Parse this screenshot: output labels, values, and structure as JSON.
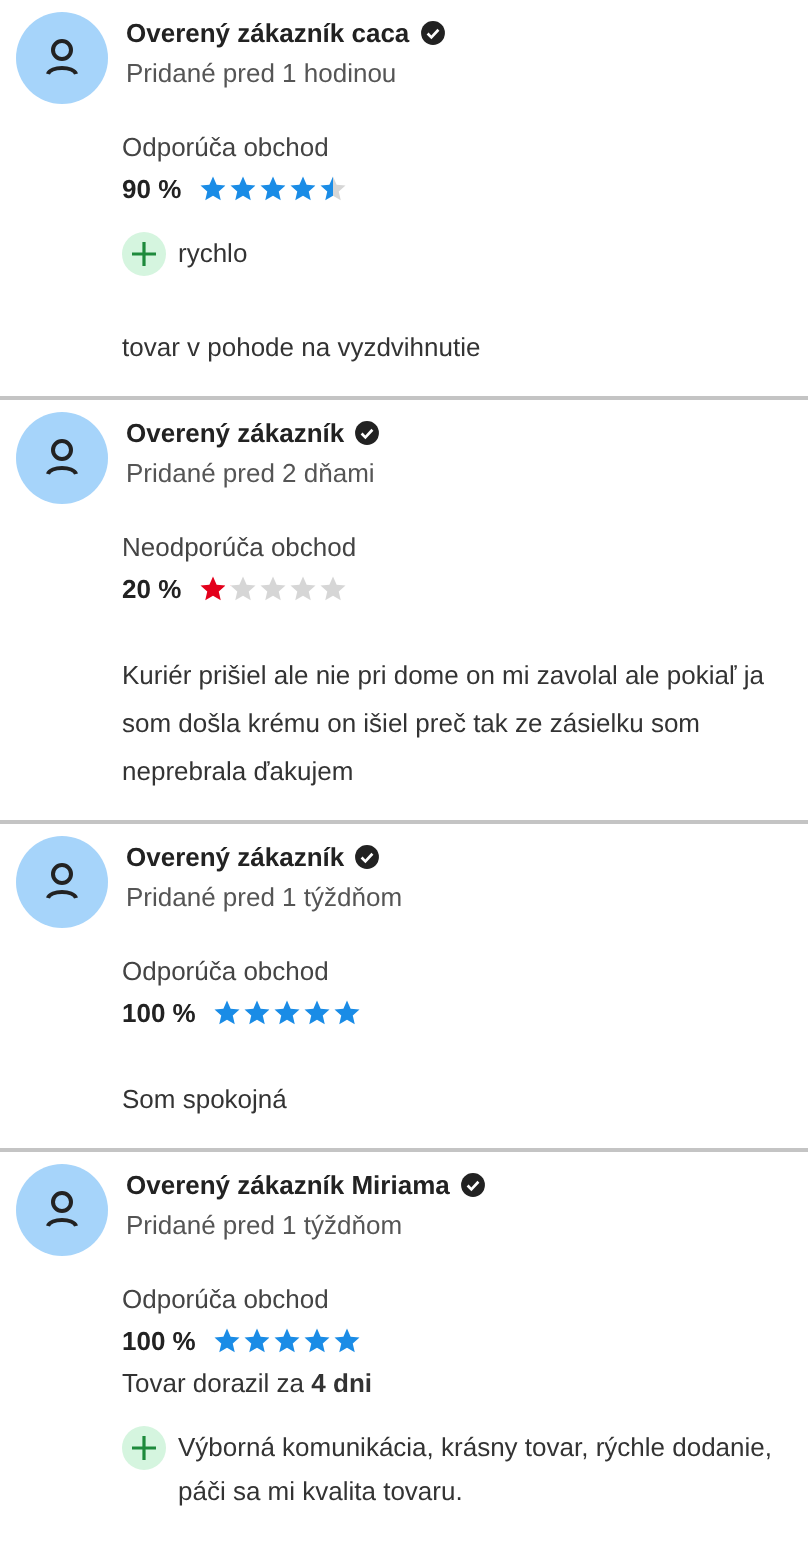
{
  "reviews": [
    {
      "author": "Overený zákazník caca",
      "verified": true,
      "date": "Pridané pred 1 hodinou",
      "verdict": "Odporúča obchod",
      "recommends": true,
      "percent": "90 %",
      "stars": 4.5,
      "pros": [
        "rychlo"
      ],
      "text": "tovar v pohode na vyzdvihnutie"
    },
    {
      "author": "Overený zákazník",
      "verified": true,
      "date": "Pridané pred 2 dňami",
      "verdict": "Neodporúča obchod",
      "recommends": false,
      "percent": "20 %",
      "stars": 1,
      "text": "Kuriér prišiel ale nie pri dome on mi zavolal ale pokiaľ ja som došla krému on išiel preč tak ze zásielku som neprebrala ďakujem"
    },
    {
      "author": "Overený zákazník",
      "verified": true,
      "date": "Pridané pred 1 týždňom",
      "verdict": "Odporúča obchod",
      "recommends": true,
      "percent": "100 %",
      "stars": 5,
      "text": "Som spokojná"
    },
    {
      "author": "Overený zákazník Miriama",
      "verified": true,
      "date": "Pridané pred 1 týždňom",
      "verdict": "Odporúča obchod",
      "recommends": true,
      "percent": "100 %",
      "stars": 5,
      "delivery": "Tovar dorazil za **4 dni**",
      "pros": [
        "Výborná komunikácia, krásny tovar, rýchle dodanie, páči sa mi kvalita tovaru."
      ]
    }
  ]
}
